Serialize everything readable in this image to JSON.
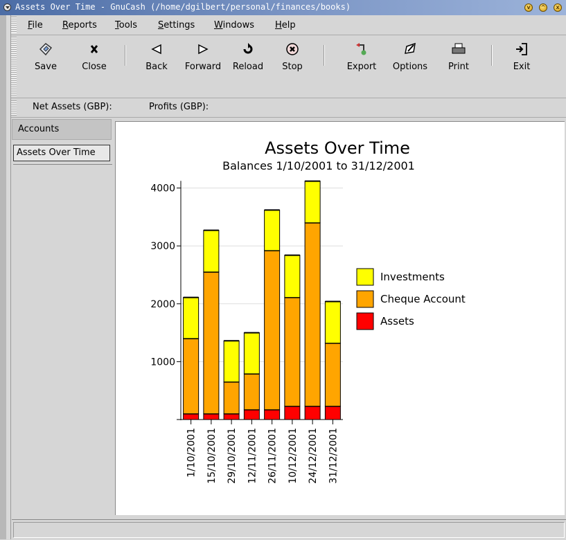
{
  "window": {
    "title": "Assets Over Time - GnuCash (/home/dgilbert/personal/finances/books)",
    "buttons": [
      "minimize",
      "maximize",
      "close"
    ]
  },
  "menu": [
    "File",
    "Reports",
    "Tools",
    "Settings",
    "Windows",
    "Help"
  ],
  "toolbar": {
    "save": "Save",
    "close": "Close",
    "back": "Back",
    "forward": "Forward",
    "reload": "Reload",
    "stop": "Stop",
    "export": "Export",
    "options": "Options",
    "print": "Print",
    "exit": "Exit"
  },
  "summary": {
    "net_assets": "Net Assets (GBP):",
    "profits": "Profits (GBP):"
  },
  "tabs": {
    "accounts": "Accounts",
    "report": "Assets Over Time"
  },
  "chart_data": {
    "type": "bar",
    "stacked": true,
    "title": "Assets Over Time",
    "subtitle": "Balances 1/10/2001 to 31/12/2001",
    "categories": [
      "1/10/2001",
      "15/10/2001",
      "29/10/2001",
      "12/11/2001",
      "26/11/2001",
      "10/12/2001",
      "24/12/2001",
      "31/12/2001"
    ],
    "series": [
      {
        "name": "Assets",
        "color": "#ff0000",
        "values": [
          100,
          100,
          100,
          170,
          170,
          230,
          230,
          230
        ]
      },
      {
        "name": "Cheque Account",
        "color": "#ffa500",
        "values": [
          1300,
          2450,
          550,
          620,
          2750,
          1880,
          3170,
          1090
        ]
      },
      {
        "name": "Investments",
        "color": "#ffff00",
        "values": [
          710,
          720,
          710,
          710,
          700,
          730,
          720,
          720
        ]
      }
    ],
    "legend_order": [
      "Investments",
      "Cheque Account",
      "Assets"
    ],
    "yticks": [
      1000,
      2000,
      3000,
      4000
    ],
    "ylim": [
      0,
      4100
    ],
    "grid": true,
    "legend": "right"
  }
}
